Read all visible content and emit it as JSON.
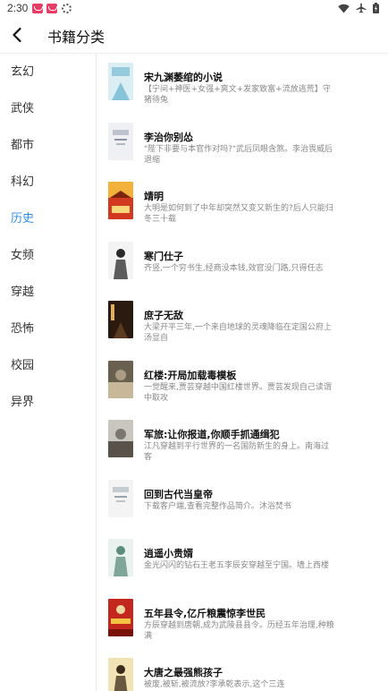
{
  "status_bar": {
    "time": "2:30"
  },
  "header": {
    "title": "书籍分类"
  },
  "sidebar": {
    "active": "历史",
    "items": [
      {
        "label": "玄幻"
      },
      {
        "label": "武侠"
      },
      {
        "label": "都市"
      },
      {
        "label": "科幻"
      },
      {
        "label": "历史"
      },
      {
        "label": "女频"
      },
      {
        "label": "穿越"
      },
      {
        "label": "恐怖"
      },
      {
        "label": "校园"
      },
      {
        "label": "异界"
      }
    ]
  },
  "books": [
    {
      "title": "宋九渊萎绾的小说",
      "desc": "【宁间+神医+女强+爽文+发家致富+流放逃荒】守猪待兔",
      "cover": {
        "bg": "#dbeef3",
        "accent": "#4fa6c8",
        "kind": "light"
      }
    },
    {
      "title": "李治你别怂",
      "desc": "\"陛下非要与本官作对吗?\"武后凤眼含煞。李治畏威后退缩",
      "cover": {
        "bg": "#eef0f3",
        "accent": "#8b93a5",
        "kind": "plain"
      }
    },
    {
      "title": "靖明",
      "desc": "大明是如何到了中年却突然又变又新生的?后人只能归冬三十载",
      "cover": {
        "bg": "#f1b13a",
        "accent": "#d23a1f",
        "kind": "palace"
      }
    },
    {
      "title": "寒门仕子",
      "desc": "齐竖,一个穷书生,经商没本钱,效官没门路,只得任志",
      "cover": {
        "bg": "#f3f3f3",
        "accent": "#2a2a2a",
        "kind": "figure"
      }
    },
    {
      "title": "庶子无敌",
      "desc": "大梁开平三年,一个来自地球的灵魂降临在定国公府上汤显自",
      "cover": {
        "bg": "#2a1a10",
        "accent": "#e0b060",
        "kind": "dark"
      }
    },
    {
      "title": "红楼:开局加载毒模板",
      "desc": "一觉醒来,贾芸穿越中国红楼世界。贾芸发现自己读谓中取攻",
      "cover": {
        "bg": "#6a6050",
        "accent": "#c8b89a",
        "kind": "gray"
      }
    },
    {
      "title": "军旅:让你报道,你顺手抓通缉犯",
      "desc": "江凡穿越到平行世界的一名国防新生的身上。南海过客",
      "cover": {
        "bg": "#c9c6c0",
        "accent": "#59524a",
        "kind": "gray"
      }
    },
    {
      "title": "回到古代当皇帝",
      "desc": "下载客户端,查看完整作品简介。沐浴焚书",
      "cover": {
        "bg": "#f4f4f4",
        "accent": "#9aa3ad",
        "kind": "plain"
      }
    },
    {
      "title": "逍遥小贵婿",
      "desc": "金光闪闪的钻石王老五李辰安穿越至宁国。墙上西楼",
      "cover": {
        "bg": "#e9f2ef",
        "accent": "#5b8c7c",
        "kind": "figure"
      }
    },
    {
      "title": "五年县令,亿斤粮震惊李世民",
      "desc": "方辰穿越到唐朝,成为武陵县县令。历经五年治理,种粮满",
      "cover": {
        "bg": "#c2281e",
        "accent": "#f4c443",
        "kind": "red"
      }
    },
    {
      "title": "大唐之最强熊孩子",
      "desc": "被废,被斩,被流放?李承乾表示,这个三连",
      "cover": {
        "bg": "#f2e3b5",
        "accent": "#3a2a1a",
        "kind": "figure"
      }
    }
  ]
}
